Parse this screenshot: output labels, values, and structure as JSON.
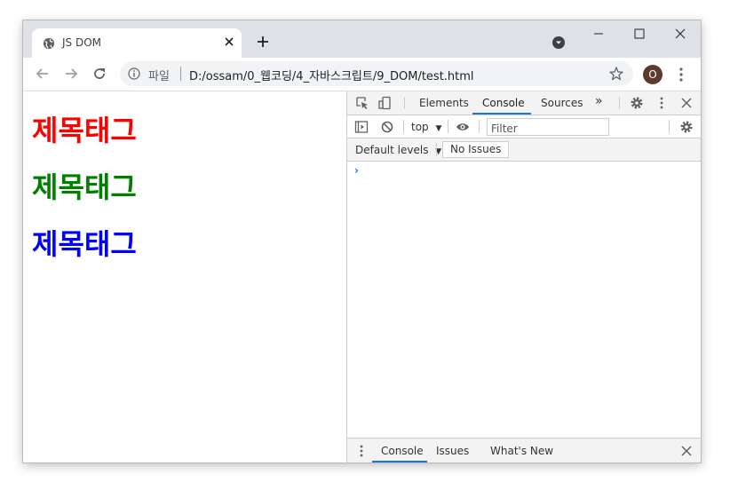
{
  "browser": {
    "tab": {
      "title": "JS DOM",
      "favicon_icon": "globe-icon",
      "close_icon": "close-icon"
    },
    "new_tab_icon": "plus-icon",
    "profile_menu_icon": "chevron-down-circle-icon",
    "window_controls": [
      "minimize-icon",
      "maximize-icon",
      "close-icon"
    ],
    "nav": {
      "back_icon": "arrow-left-icon",
      "forward_icon": "arrow-right-icon",
      "reload_icon": "reload-icon"
    },
    "omnibox": {
      "info_icon": "info-icon",
      "scheme_label": "파일",
      "url": "D:/ossam/0_웹코딩/4_자바스크립트/9_DOM/test.html",
      "bookmark_icon": "star-icon"
    },
    "profile_initial": "O",
    "menu_icon": "kebab-menu-icon"
  },
  "page": {
    "headings": [
      {
        "text": "제목태그",
        "color": "#ff0000"
      },
      {
        "text": "제목태그",
        "color": "#008000"
      },
      {
        "text": "제목태그",
        "color": "#0000ff"
      }
    ]
  },
  "devtools": {
    "tabs": [
      "Elements",
      "Console",
      "Sources"
    ],
    "active_tab": "Console",
    "more_tabs_glyph": "»",
    "context": "top",
    "filter_placeholder": "Filter",
    "levels_label": "Default levels",
    "issues_button": "No Issues",
    "console_prompt": "›",
    "drawer_tabs": [
      "Console",
      "Issues",
      "What's New"
    ],
    "active_drawer_tab": "Console",
    "accent_color": "#1a73e8"
  }
}
